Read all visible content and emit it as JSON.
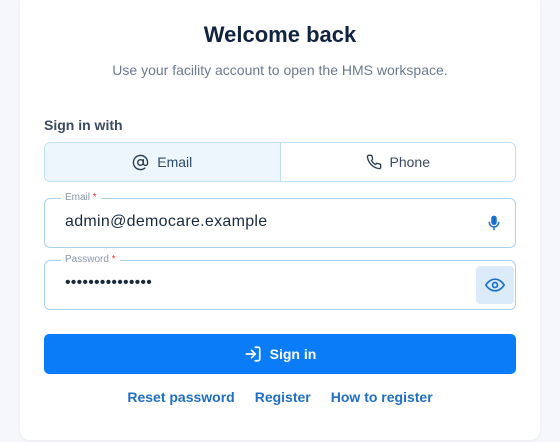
{
  "header": {
    "title": "Welcome back",
    "subtitle": "Use your facility account to open the HMS workspace."
  },
  "sign_in_with": {
    "label": "Sign in with",
    "options": [
      {
        "label": "Email",
        "icon": "at-icon",
        "selected": true
      },
      {
        "label": "Phone",
        "icon": "phone-icon",
        "selected": false
      }
    ]
  },
  "email_field": {
    "label": "Email",
    "required_mark": "*",
    "value": "admin@democare.example"
  },
  "password_field": {
    "label": "Password",
    "required_mark": "*",
    "value": "•••••••••••••••"
  },
  "signin_button": {
    "label": "Sign in",
    "icon": "sign-in-icon"
  },
  "links": {
    "reset": "Reset password",
    "register": "Register",
    "how_to": "How to register"
  },
  "colors": {
    "primary": "#0a7cf8",
    "link": "#1f6fc4",
    "required": "#e5393a",
    "border": "#a9d2ee"
  }
}
